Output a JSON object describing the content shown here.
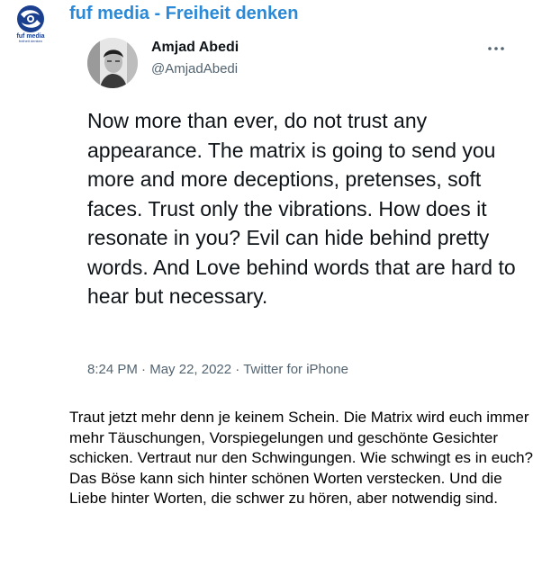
{
  "channel": {
    "name": "fuf media - Freiheit denken",
    "logo_text": "fuf media",
    "logo_subtext": "freiheit denken",
    "logo_icon": "swirl-logo-icon"
  },
  "tweet": {
    "author_name": "Amjad Abedi",
    "author_handle": "@AmjadAbedi",
    "more_icon": "more-dots-icon",
    "text": "Now more than ever, do not trust any appearance. The matrix is going to send you more and more deceptions, pretenses, soft faces. Trust only the vibrations. How does it resonate in you? Evil can hide behind pretty words. And Love behind words that are hard to hear but necessary.",
    "time": "8:24 PM",
    "separator": "·",
    "date": "May 22, 2022",
    "source": "Twitter for iPhone"
  },
  "translation": {
    "text": "Traut jetzt mehr denn je keinem Schein. Die Matrix wird euch immer mehr Täuschungen, Vorspiegelungen und geschönte Gesichter schicken. Vertraut nur den Schwingungen. Wie schwingt es in euch? Das Böse kann sich hinter schönen Worten verstecken. Und die Liebe hinter Worten, die schwer zu hören, aber notwendig sind."
  },
  "colors": {
    "channel_name": "#2a8ad8",
    "logo": "#1a3f8f",
    "tweet_text": "#0f1419",
    "tweet_secondary": "#536471"
  }
}
